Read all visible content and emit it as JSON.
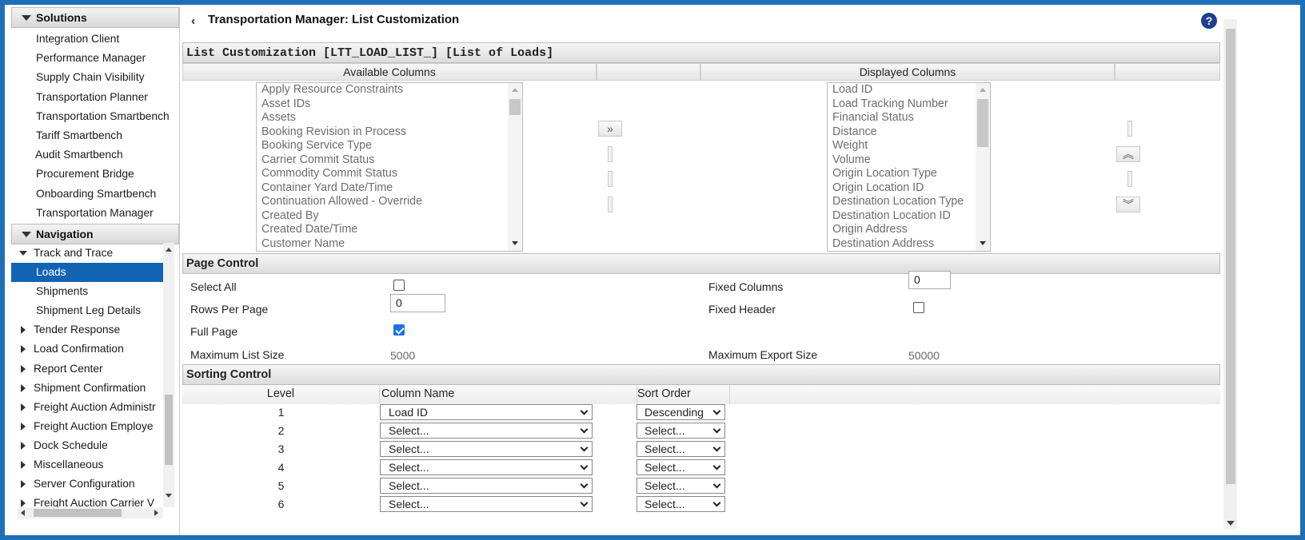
{
  "sidebar": {
    "solutions_header": "Solutions",
    "solutions": [
      "Integration Client",
      "Performance Manager",
      "Supply Chain Visibility",
      "Transportation Planner",
      "Transportation Smartbench",
      "Tariff Smartbench",
      "Audit Smartbench",
      "Procurement Bridge",
      "Onboarding Smartbench",
      "Transportation Manager"
    ],
    "navigation_header": "Navigation",
    "tree": [
      {
        "label": "Track and Trace"
      },
      {
        "label": "Loads"
      },
      {
        "label": "Shipments"
      },
      {
        "label": "Shipment Leg Details"
      },
      {
        "label": "Tender Response"
      },
      {
        "label": "Load Confirmation"
      },
      {
        "label": "Report Center"
      },
      {
        "label": "Shipment Confirmation"
      },
      {
        "label": "Freight Auction Administr"
      },
      {
        "label": "Freight Auction Employe"
      },
      {
        "label": "Dock Schedule"
      },
      {
        "label": "Miscellaneous"
      },
      {
        "label": "Server Configuration"
      },
      {
        "label": "Freight Auction Carrier V"
      }
    ]
  },
  "header": {
    "title": "Transportation Manager: List Customization",
    "back_icon": "‹",
    "help_label": "?"
  },
  "list_customization": {
    "title": "List Customization [LTT_LOAD_LIST_] [List of Loads]",
    "available_header": "Available Columns",
    "displayed_header": "Displayed Columns",
    "add_button": "»",
    "move_up_button": "︽",
    "move_down_button": "︾",
    "available": [
      "Apply Resource Constraints",
      "Asset IDs",
      "Assets",
      "Booking Revision in Process",
      "Booking Service Type",
      "Carrier Commit Status",
      "Commodity Commit Status",
      "Container Yard Date/Time",
      "Continuation Allowed - Override",
      "Created By",
      "Created Date/Time",
      "Customer Name"
    ],
    "displayed": [
      "Load ID",
      "Load Tracking Number",
      "Financial Status",
      "Distance",
      "Weight",
      "Volume",
      "Origin Location Type",
      "Origin Location ID",
      "Destination Location Type",
      "Destination Location ID",
      "Origin Address",
      "Destination Address"
    ]
  },
  "page_control": {
    "header": "Page Control",
    "select_all_label": "Select All",
    "select_all": false,
    "rows_per_page_label": "Rows Per Page",
    "rows_per_page": "0",
    "full_page_label": "Full Page",
    "full_page": true,
    "max_list_size_label": "Maximum List Size",
    "max_list_size": "5000",
    "fixed_columns_label": "Fixed Columns",
    "fixed_columns": "0",
    "fixed_header_label": "Fixed Header",
    "fixed_header": false,
    "max_export_size_label": "Maximum Export Size",
    "max_export_size": "50000"
  },
  "sorting_control": {
    "header": "Sorting Control",
    "level_header": "Level",
    "column_name_header": "Column Name",
    "sort_order_header": "Sort Order",
    "rows": [
      {
        "level": "1",
        "column": "Load ID",
        "order": "Descending"
      },
      {
        "level": "2",
        "column": "Select...",
        "order": "Select..."
      },
      {
        "level": "3",
        "column": "Select...",
        "order": "Select..."
      },
      {
        "level": "4",
        "column": "Select...",
        "order": "Select..."
      },
      {
        "level": "5",
        "column": "Select...",
        "order": "Select..."
      },
      {
        "level": "6",
        "column": "Select...",
        "order": "Select..."
      }
    ]
  }
}
